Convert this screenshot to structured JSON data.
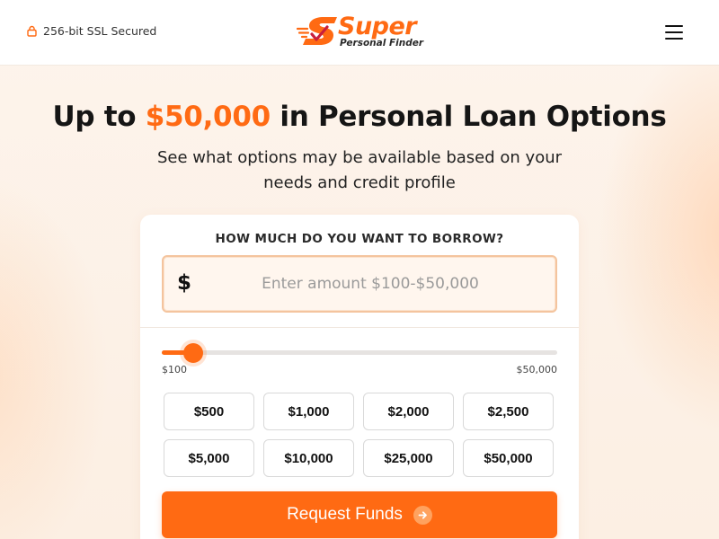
{
  "header": {
    "ssl_text": "256-bit SSL Secured",
    "brand_name": "Super",
    "brand_tagline": "Personal Finder",
    "menu_icon": "hamburger-menu-icon"
  },
  "hero": {
    "headline_prefix": "Up to ",
    "headline_amount": "$50,000",
    "headline_suffix": " in Personal Loan Options",
    "subheading": "See what options may be available based on your needs and credit profile"
  },
  "form": {
    "question": "HOW MUCH DO YOU WANT TO BORROW?",
    "currency_symbol": "$",
    "amount_value": "",
    "amount_placeholder": "Enter amount $100-$50,000",
    "slider": {
      "min_label": "$100",
      "max_label": "$50,000",
      "level_fraction": 0.08
    },
    "presets": [
      "$500",
      "$1,000",
      "$2,000",
      "$2,500",
      "$5,000",
      "$10,000",
      "$25,000",
      "$50,000"
    ],
    "submit_label": "Request Funds"
  },
  "colors": {
    "accent": "#ff6a13",
    "text": "#151515",
    "page_background": "#fdf3ea",
    "card_background": "#ffffff"
  },
  "icons": {
    "lock": "lock-icon",
    "logo": "logo-mark-icon",
    "cta_arrow": "arrow-right-icon"
  }
}
